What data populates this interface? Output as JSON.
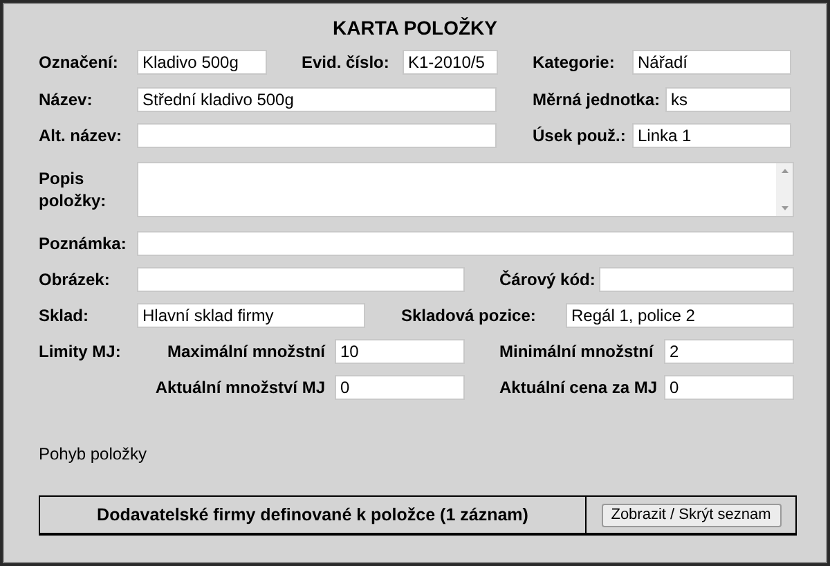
{
  "title": "KARTA POLOŽKY",
  "fields": [
    {
      "label": "Označení:",
      "value": "Kladivo 500g"
    },
    {
      "label": "Evid. číslo:",
      "value": "K1-2010/5"
    },
    {
      "label": "Kategorie:",
      "value": "Nářadí"
    },
    {
      "label": "Název:",
      "value": "Střední kladivo 500g"
    },
    {
      "label": "Měrná jednotka:",
      "value": "ks"
    },
    {
      "label": "Alt. název:"
    },
    {
      "label": "Úsek použ.:",
      "value": "Linka 1"
    },
    {
      "label": "Popis položky:"
    },
    {
      "label": "Poznámka:"
    },
    {
      "label": "Obrázek:"
    },
    {
      "label": "Čárový kód:"
    },
    {
      "label": "Sklad:",
      "value": "Hlavní sklad firmy"
    },
    {
      "label": "Skladová pozice:",
      "value": "Regál 1, police 2"
    },
    {
      "label": "Maximální množstní",
      "value": "10"
    },
    {
      "label": "Minimální množstní",
      "value": "2"
    },
    {
      "label": "Aktuální množství MJ",
      "value": "0"
    },
    {
      "label": "Aktuální cena za MJ",
      "value": "0"
    }
  ],
  "limits_label": "Limity MJ:",
  "movement_label": "Pohyb položky",
  "suppliers": {
    "text": "Dodavatelské firmy definované k položce (1 záznam)",
    "button": "Zobrazit / Skrýt seznam"
  }
}
